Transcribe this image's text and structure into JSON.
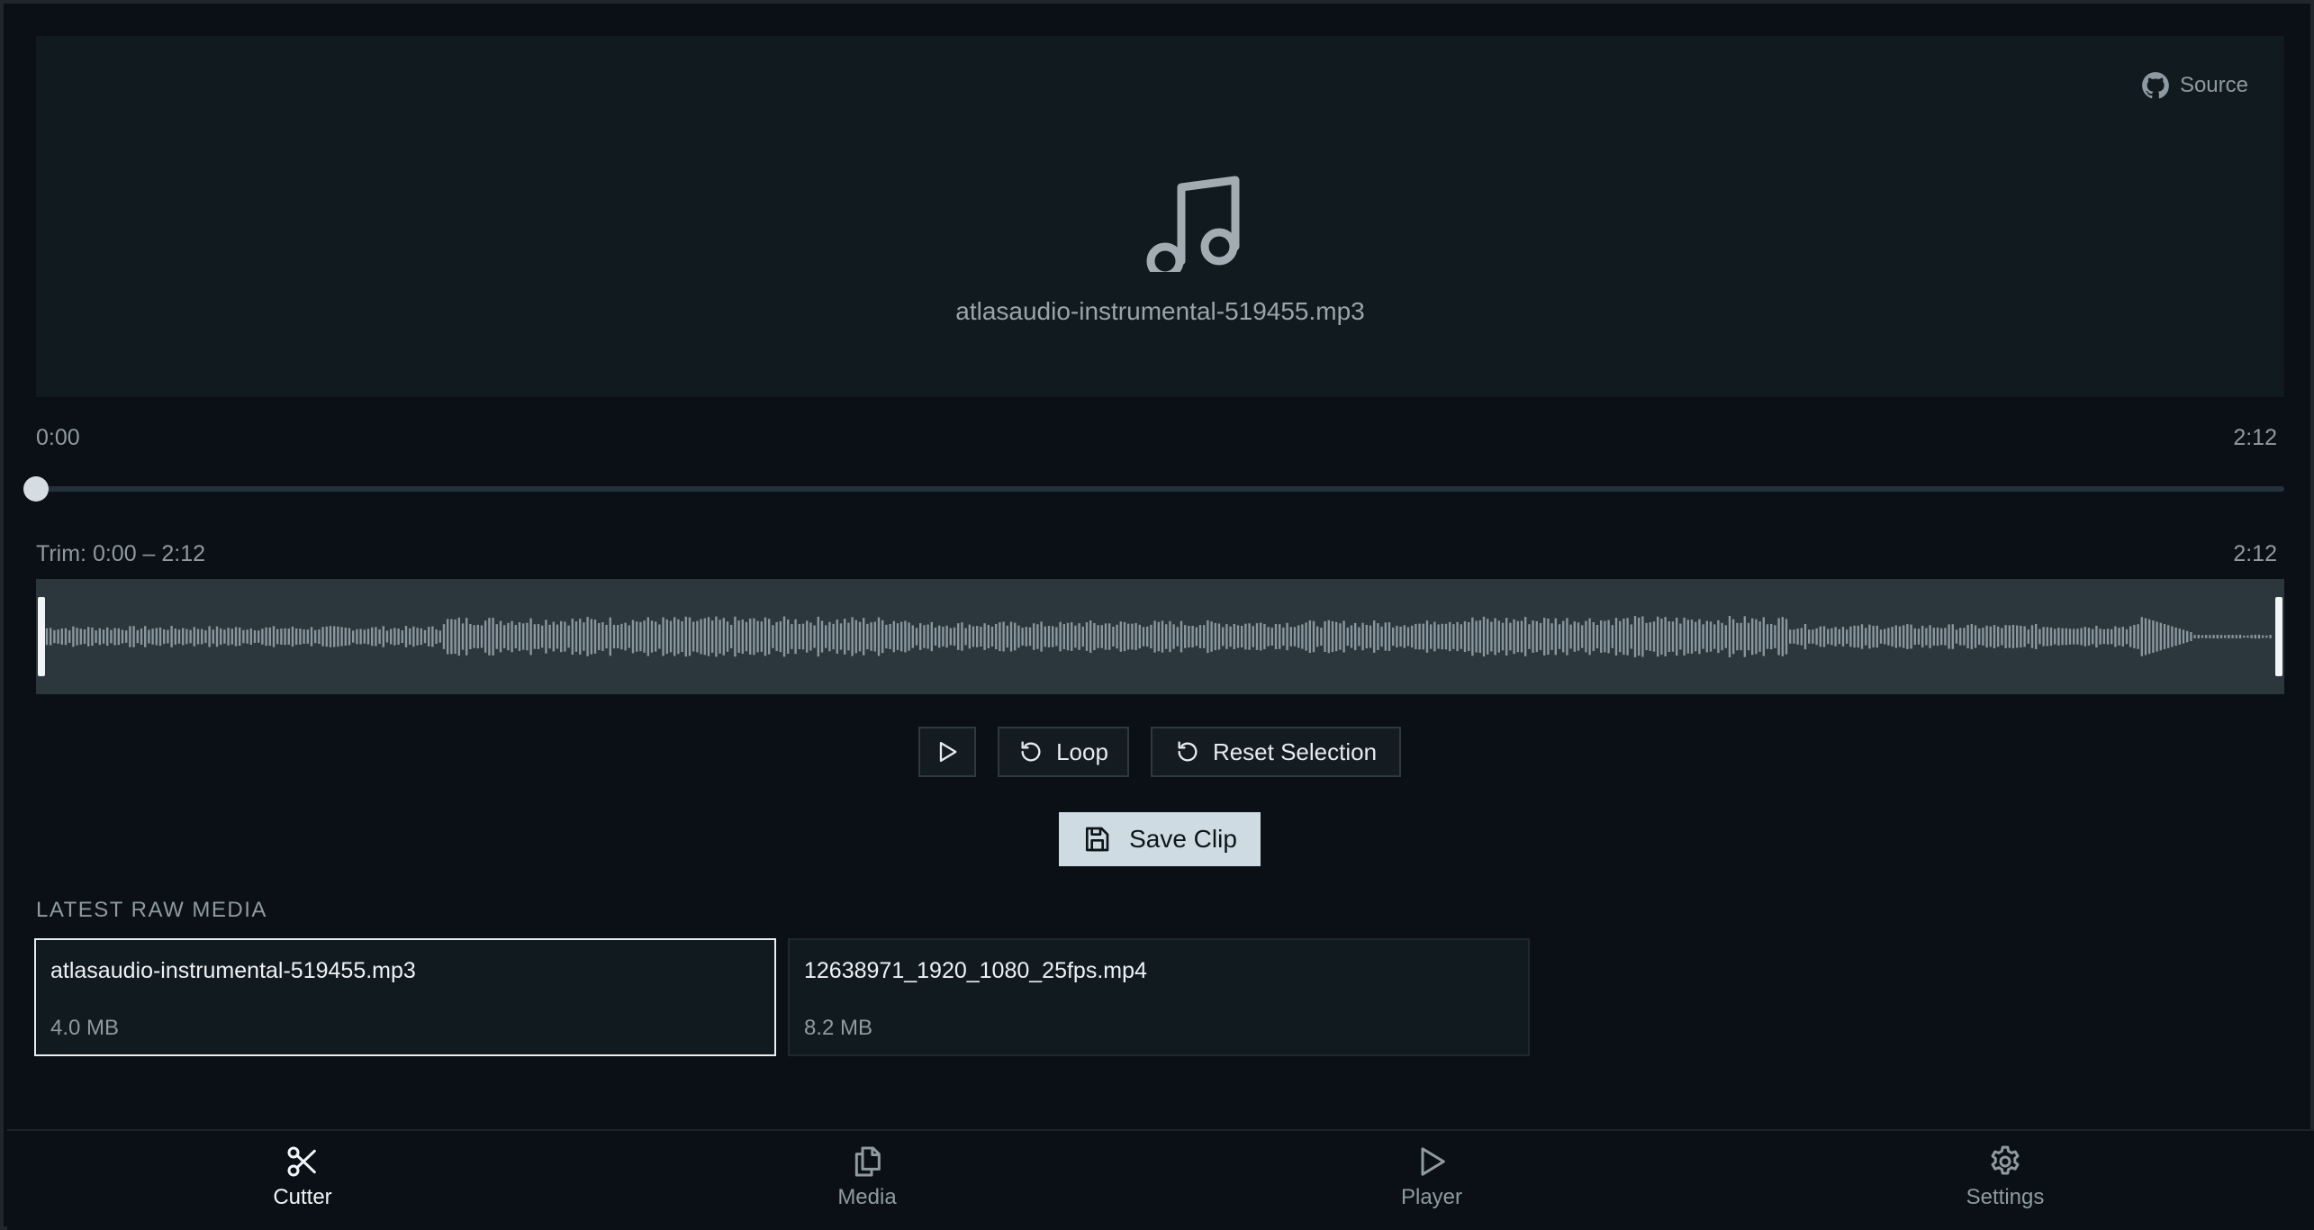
{
  "preview": {
    "source_label": "Source",
    "media_name": "atlasaudio-instrumental-519455.mp3",
    "icon": "music-note-icon"
  },
  "player": {
    "current_time": "0:00",
    "duration": "2:12",
    "progress": 0
  },
  "trim": {
    "label": "Trim: 0:00 – 2:12",
    "end_label": "2:12",
    "selection_start": 0,
    "selection_end": 1
  },
  "controls": {
    "play_icon": "play-icon",
    "loop_label": "Loop",
    "reset_label": "Reset Selection",
    "save_label": "Save Clip"
  },
  "media": {
    "section_title": "LATEST RAW MEDIA",
    "items": [
      {
        "name": "atlasaudio-instrumental-519455.mp3",
        "size": "4.0 MB",
        "selected": true
      },
      {
        "name": "12638971_1920_1080_25fps.mp4",
        "size": "8.2 MB",
        "selected": false
      }
    ]
  },
  "nav": {
    "items": [
      {
        "label": "Cutter",
        "icon": "scissors-icon",
        "active": true
      },
      {
        "label": "Media",
        "icon": "files-icon",
        "active": false
      },
      {
        "label": "Player",
        "icon": "play-icon",
        "active": false
      },
      {
        "label": "Settings",
        "icon": "gear-icon",
        "active": false
      }
    ]
  },
  "colors": {
    "background": "#0a1015",
    "panel": "#111a1e",
    "waveform": "#8a969d",
    "accent_button": "#cfdbe3"
  }
}
